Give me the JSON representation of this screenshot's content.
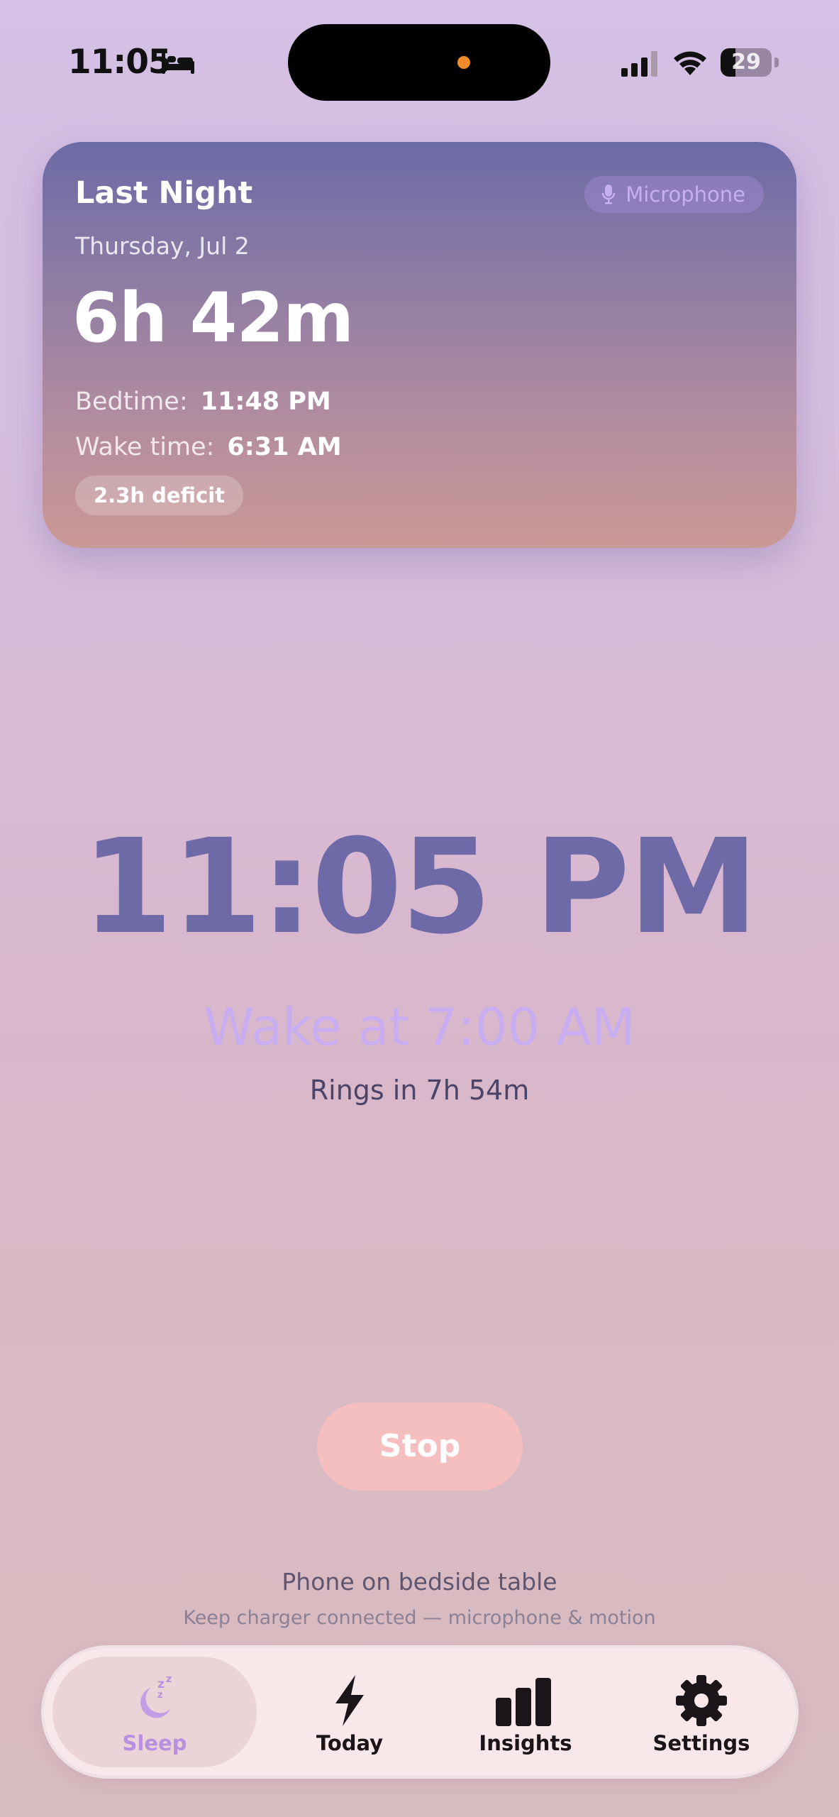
{
  "status_bar": {
    "time": "11:05",
    "battery_level": "29",
    "battery_percent": 29,
    "icons": [
      "bed-icon",
      "signal-icon",
      "wifi-icon",
      "battery-icon"
    ]
  },
  "last_night_card": {
    "title": "Last Night",
    "source_label": "Microphone",
    "source_icon": "microphone-icon",
    "date": "Thursday, Jul 2",
    "duration": "6h 42m",
    "bedtime_label": "Bedtime:",
    "bedtime_value": "11:48 PM",
    "wake_label": "Wake time:",
    "wake_value": "6:31 AM",
    "deficit": "2.3h deficit"
  },
  "clock": {
    "time": "11:05 PM",
    "wake_at": "Wake at 7:00 AM",
    "rings_in": "Rings in 7h 54m"
  },
  "stop_button": {
    "label": "Stop"
  },
  "hint": {
    "title": "Phone on bedside table",
    "subtitle": "Keep charger connected — microphone & motion"
  },
  "tab_bar": {
    "tabs": [
      {
        "label": "Sleep",
        "icon": "moon-zzz-icon",
        "active": true
      },
      {
        "label": "Today",
        "icon": "lightning-bolt-icon",
        "active": false
      },
      {
        "label": "Insights",
        "icon": "bar-chart-icon",
        "active": false
      },
      {
        "label": "Settings",
        "icon": "gear-icon",
        "active": false
      }
    ]
  },
  "colors": {
    "background_top": "#d5c0e6",
    "background_bottom": "#d9bcc0",
    "card_top": "#6c6aa6",
    "card_bottom": "#ca9895",
    "clock": "#6e6aa8",
    "wake_at": "#c8aef0",
    "stop_button": "#f5bfc0",
    "active_tab": "#b98fe0"
  }
}
